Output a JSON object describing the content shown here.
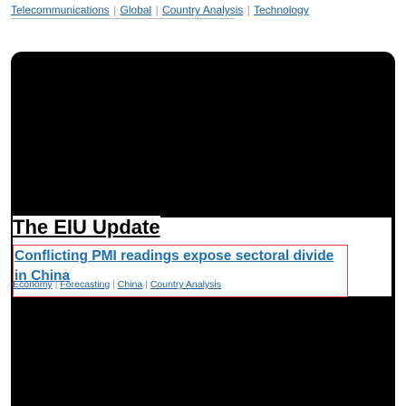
{
  "top_tags": [
    "Telecommunications",
    "Global",
    "Country Analysis",
    "Technology"
  ],
  "separator": "|",
  "section": {
    "title": "The EIU Update"
  },
  "article": {
    "headline": "Conflicting PMI readings expose sectoral divide in China",
    "tags": [
      "Economy",
      "Forecasting",
      "China",
      "Country Analysis"
    ]
  },
  "colors": {
    "link": "#1f5f9a",
    "headline": "#1d6fb0",
    "highlight_border": "#d84848",
    "card_background": "#000000"
  }
}
